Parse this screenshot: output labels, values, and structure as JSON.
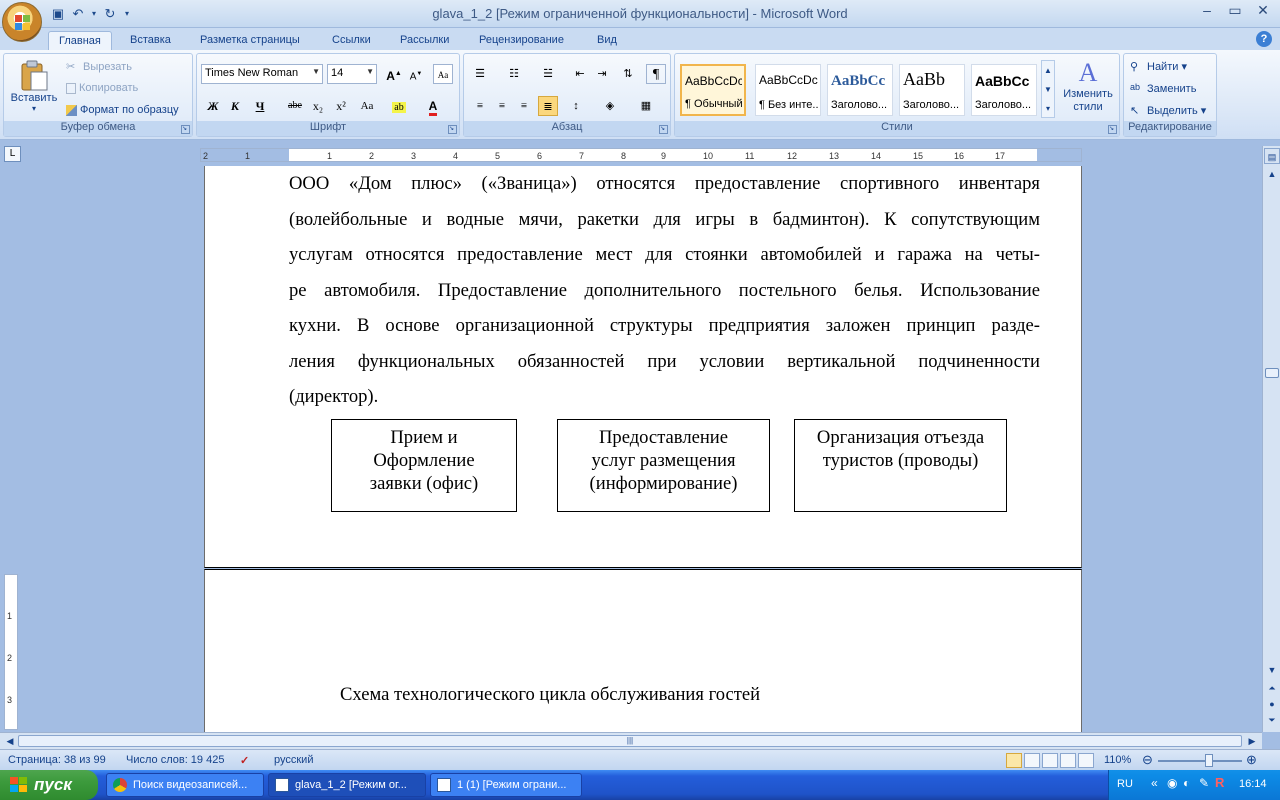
{
  "window": {
    "title": "glava_1_2 [Режим ограниченной функциональности] - Microsoft Word"
  },
  "tabs": [
    "Главная",
    "Вставка",
    "Разметка страницы",
    "Ссылки",
    "Рассылки",
    "Рецензирование",
    "Вид"
  ],
  "ribbon": {
    "clipboard": {
      "paste": "Вставить",
      "cut": "Вырезать",
      "copy": "Копировать",
      "format_painter": "Формат по образцу",
      "label": "Буфер обмена"
    },
    "font": {
      "name": "Times New Roman",
      "size": "14",
      "bold": "Ж",
      "italic": "К",
      "underline": "Ч",
      "strike": "abe",
      "subscript": "x₂",
      "superscript": "x²",
      "change_case": "Aa",
      "label": "Шрифт"
    },
    "paragraph": {
      "label": "Абзац"
    },
    "styles": {
      "items": [
        {
          "sample": "AaBbCcDc",
          "name": "¶ Обычный"
        },
        {
          "sample": "AaBbCcDc",
          "name": "¶ Без инте..."
        },
        {
          "sample": "AaBbCc",
          "name": "Заголово..."
        },
        {
          "sample": "AaBb",
          "name": "Заголово..."
        },
        {
          "sample": "AaBbCc",
          "name": "Заголово..."
        }
      ],
      "change_styles": "Изменить стили",
      "label": "Стили"
    },
    "editing": {
      "find": "Найти",
      "replace": "Заменить",
      "select": "Выделить",
      "label": "Редактирование"
    }
  },
  "ruler": {
    "ticks": [
      "2",
      "1",
      "1",
      "2",
      "3",
      "4",
      "5",
      "6",
      "7",
      "8",
      "9",
      "10",
      "11",
      "12",
      "13",
      "14",
      "15",
      "16",
      "17"
    ],
    "vticks": [
      "1",
      "2",
      "3"
    ]
  },
  "document": {
    "paragraph_lines": [
      "ООО «Дом плюс» («Званица») относятся предоставление спортивного инвентаря",
      "(волейбольные и водные мячи, ракетки для игры в бадминтон). К сопутствующим",
      "услугам относятся предоставление мест для стоянки автомобилей и гаража на четы-",
      "ре автомобиля. Предоставление дополнительного постельного белья. Использование",
      "кухни. В основе организационной структуры предприятия заложен принцип разде-",
      "ления функциональных обязанностей при условии вертикальной подчиненности",
      "(директор)."
    ],
    "boxes": [
      {
        "lines": [
          "Прием и",
          "Оформление",
          "заявки (офис)"
        ]
      },
      {
        "lines": [
          "Предоставление",
          "услуг размещения",
          "(информирование)"
        ]
      },
      {
        "lines": [
          "Организация отъезда",
          "туристов (проводы)"
        ]
      }
    ],
    "caption": "Схема технологического цикла обслуживания гостей"
  },
  "statusbar": {
    "page": "Страница: 38 из 99",
    "words": "Число слов: 19 425",
    "language": "русский",
    "zoom": "110%"
  },
  "taskbar": {
    "start": "пуск",
    "tasks": [
      "Поиск видеозаписей...",
      "glava_1_2 [Режим ог...",
      "1 (1) [Режим ограни..."
    ],
    "lang": "RU",
    "clock": "16:14"
  }
}
